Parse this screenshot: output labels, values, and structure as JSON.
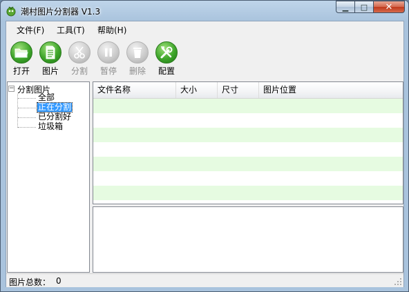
{
  "window": {
    "title": "潮村图片分割器 V1.3"
  },
  "menu": [
    "文件(F)",
    "工具(T)",
    "帮助(H)"
  ],
  "toolbar": [
    {
      "label": "打开",
      "icon": "folder-open-icon",
      "enabled": true
    },
    {
      "label": "图片",
      "icon": "document-icon",
      "enabled": true
    },
    {
      "label": "分割",
      "icon": "scissors-icon",
      "enabled": false
    },
    {
      "label": "暂停",
      "icon": "pause-icon",
      "enabled": false
    },
    {
      "label": "删除",
      "icon": "trash-icon",
      "enabled": false
    },
    {
      "label": "配置",
      "icon": "tools-icon",
      "enabled": true
    }
  ],
  "tree": {
    "root": "分割图片",
    "children": [
      "全部",
      "正在分割",
      "已分割好",
      "垃圾箱"
    ],
    "selected_index": 1
  },
  "list": {
    "columns": [
      "文件名称",
      "大小",
      "尺寸",
      "图片位置"
    ],
    "row_colors": {
      "odd": "#e6fbe1",
      "even": "#ffffff"
    }
  },
  "status": {
    "label": "图片总数：",
    "value": "0"
  }
}
